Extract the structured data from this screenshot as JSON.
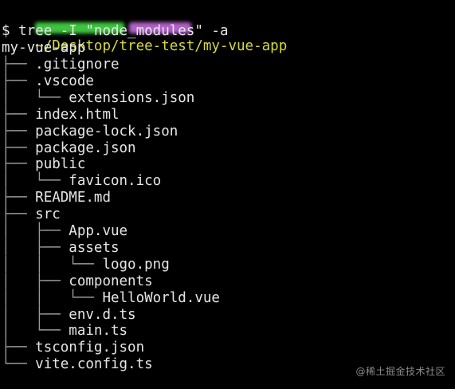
{
  "colors": {
    "background": "#000000",
    "text": "#e6e6e6",
    "path": "#d9d93a",
    "tree_branches": "#9a9a9a",
    "redacted_user": "#3ec43e",
    "redacted_host": "#b062c7"
  },
  "prompt": {
    "cwd": "~/Desktop/tree-test/my-vue-app",
    "symbol": "$",
    "command": "tree -I \"node_modules\" -a"
  },
  "tree_output": {
    "root": "my-vue-app",
    "entries": [
      {
        "prefix": "├── ",
        "name": ".gitignore"
      },
      {
        "prefix": "├── ",
        "name": ".vscode"
      },
      {
        "prefix": "│   └── ",
        "name": "extensions.json"
      },
      {
        "prefix": "├── ",
        "name": "index.html"
      },
      {
        "prefix": "├── ",
        "name": "package-lock.json"
      },
      {
        "prefix": "├── ",
        "name": "package.json"
      },
      {
        "prefix": "├── ",
        "name": "public"
      },
      {
        "prefix": "│   └── ",
        "name": "favicon.ico"
      },
      {
        "prefix": "├── ",
        "name": "README.md"
      },
      {
        "prefix": "├── ",
        "name": "src"
      },
      {
        "prefix": "│   ├── ",
        "name": "App.vue"
      },
      {
        "prefix": "│   ├── ",
        "name": "assets"
      },
      {
        "prefix": "│   │   └── ",
        "name": "logo.png"
      },
      {
        "prefix": "│   ├── ",
        "name": "components"
      },
      {
        "prefix": "│   │   └── ",
        "name": "HelloWorld.vue"
      },
      {
        "prefix": "│   ├── ",
        "name": "env.d.ts"
      },
      {
        "prefix": "│   └── ",
        "name": "main.ts"
      },
      {
        "prefix": "├── ",
        "name": "tsconfig.json"
      },
      {
        "prefix": "└── ",
        "name": "vite.config.ts"
      }
    ]
  },
  "watermark": "@稀土掘金技术社区"
}
